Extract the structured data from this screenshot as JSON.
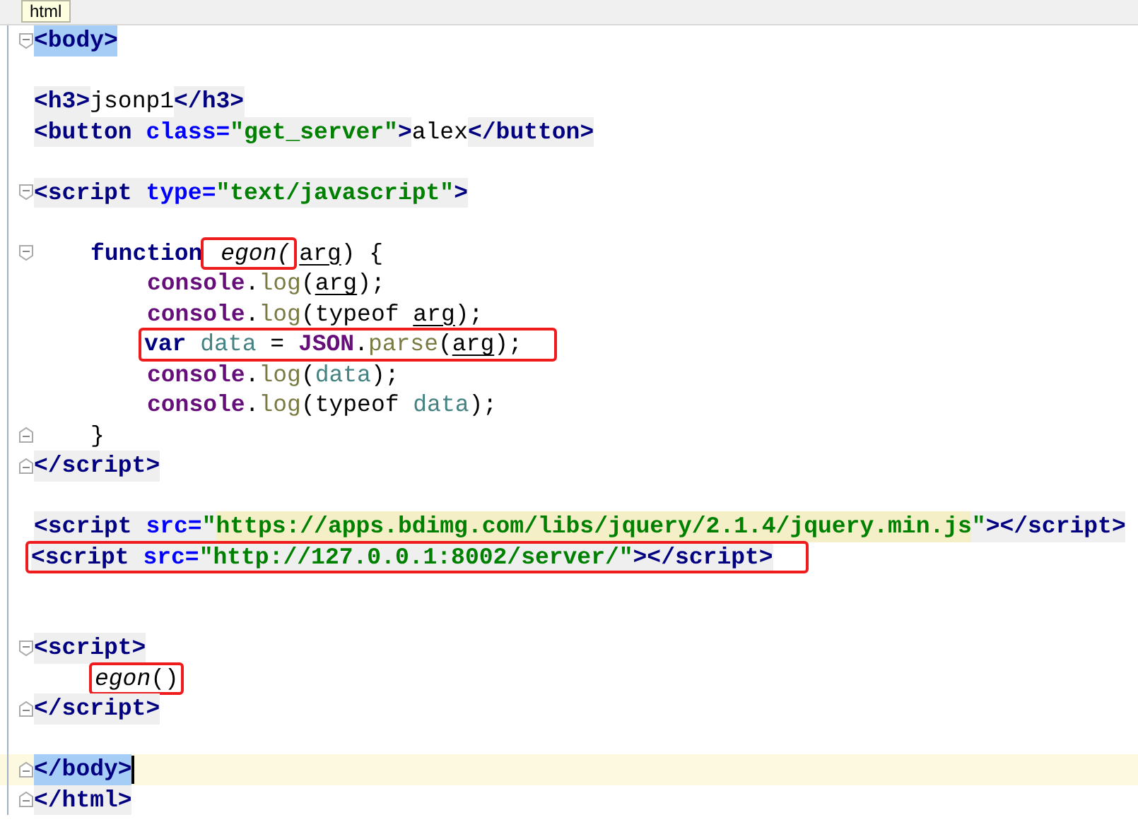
{
  "breadcrumb_tooltip": "html",
  "lines": [
    {
      "kind": "code",
      "fold_start": true,
      "tokens": [
        {
          "text": "<body>",
          "kind": "tag",
          "matched": true
        }
      ]
    },
    {
      "kind": "blank"
    },
    {
      "kind": "code",
      "tokens": [
        {
          "text": "<h3>",
          "kind": "tag"
        },
        {
          "text": "jsonp1",
          "kind": "text"
        },
        {
          "text": "</h3>",
          "kind": "tag"
        }
      ]
    },
    {
      "kind": "code",
      "tokens": [
        {
          "text": "<button ",
          "kind": "tag"
        },
        {
          "text": "class=",
          "kind": "attr"
        },
        {
          "text": "\"get_server\"",
          "kind": "string"
        },
        {
          "text": ">",
          "kind": "tag"
        },
        {
          "text": "alex",
          "kind": "text"
        },
        {
          "text": "</button>",
          "kind": "tag"
        }
      ]
    },
    {
      "kind": "blank"
    },
    {
      "kind": "code",
      "fold_start": true,
      "tokens": [
        {
          "text": "<script ",
          "kind": "tag"
        },
        {
          "text": "type=",
          "kind": "attr"
        },
        {
          "text": "\"text/javascript\"",
          "kind": "string"
        },
        {
          "text": ">",
          "kind": "tag"
        }
      ],
      "children": [
        {
          "kind": "blank"
        },
        {
          "kind": "code",
          "fold_start": true,
          "tokens": [
            {
              "text": "function",
              "kind": "keyword"
            },
            {
              "text": " egon(",
              "kind": "call",
              "boxed": true
            },
            {
              "text": "arg",
              "kind": "param"
            },
            {
              "text": ") {",
              "kind": "text"
            }
          ],
          "children": [
            {
              "kind": "code",
              "tokens": [
                {
                  "text": "console",
                  "kind": "object"
                },
                {
                  "text": ".",
                  "kind": "text"
                },
                {
                  "text": "log",
                  "kind": "method"
                },
                {
                  "text": "(",
                  "kind": "text"
                },
                {
                  "text": "arg",
                  "kind": "param"
                },
                {
                  "text": ");",
                  "kind": "text"
                }
              ]
            },
            {
              "kind": "code",
              "tokens": [
                {
                  "text": "console",
                  "kind": "object"
                },
                {
                  "text": ".",
                  "kind": "text"
                },
                {
                  "text": "log",
                  "kind": "method"
                },
                {
                  "text": "(typeof ",
                  "kind": "text"
                },
                {
                  "text": "arg",
                  "kind": "param"
                },
                {
                  "text": ");",
                  "kind": "text"
                }
              ]
            },
            {
              "kind": "code",
              "boxed": true,
              "tokens": [
                {
                  "text": "var",
                  "kind": "keyword"
                },
                {
                  "text": " data",
                  "kind": "variable"
                },
                {
                  "text": " = ",
                  "kind": "text"
                },
                {
                  "text": "JSON",
                  "kind": "object"
                },
                {
                  "text": ".",
                  "kind": "text"
                },
                {
                  "text": "parse",
                  "kind": "method"
                },
                {
                  "text": "(",
                  "kind": "text"
                },
                {
                  "text": "arg",
                  "kind": "param"
                },
                {
                  "text": ");",
                  "kind": "text"
                }
              ]
            },
            {
              "kind": "code",
              "tokens": [
                {
                  "text": "console",
                  "kind": "object"
                },
                {
                  "text": ".",
                  "kind": "text"
                },
                {
                  "text": "log",
                  "kind": "method"
                },
                {
                  "text": "(",
                  "kind": "text"
                },
                {
                  "text": "data",
                  "kind": "variable"
                },
                {
                  "text": ");",
                  "kind": "text"
                }
              ]
            },
            {
              "kind": "code",
              "tokens": [
                {
                  "text": "console",
                  "kind": "object"
                },
                {
                  "text": ".",
                  "kind": "text"
                },
                {
                  "text": "log",
                  "kind": "method"
                },
                {
                  "text": "(typeof ",
                  "kind": "text"
                },
                {
                  "text": "data",
                  "kind": "variable"
                },
                {
                  "text": ");",
                  "kind": "text"
                }
              ]
            }
          ]
        },
        {
          "kind": "code",
          "fold_end": true,
          "tokens": [
            {
              "text": "}",
              "kind": "text"
            }
          ]
        }
      ]
    },
    {
      "kind": "code",
      "fold_end": true,
      "tokens": [
        {
          "text": "</script>",
          "kind": "tag"
        }
      ]
    },
    {
      "kind": "blank"
    },
    {
      "kind": "code",
      "tokens": [
        {
          "text": "<script ",
          "kind": "tag"
        },
        {
          "text": "src=",
          "kind": "attr"
        },
        {
          "text": "\"",
          "kind": "string"
        },
        {
          "text": "https://apps.bdimg.com/libs/jquery/2.1.4/jquery.min.js",
          "kind": "string",
          "injected": true
        },
        {
          "text": "\"",
          "kind": "string"
        },
        {
          "text": "></script>",
          "kind": "tag"
        }
      ]
    },
    {
      "kind": "code",
      "boxed": true,
      "tokens": [
        {
          "text": "<script ",
          "kind": "tag"
        },
        {
          "text": "src=",
          "kind": "attr"
        },
        {
          "text": "\"http://127.0.0.1:8002/server/\"",
          "kind": "string"
        },
        {
          "text": "></script>",
          "kind": "tag"
        }
      ]
    },
    {
      "kind": "blank"
    },
    {
      "kind": "blank"
    },
    {
      "kind": "code",
      "fold_start": true,
      "tokens": [
        {
          "text": "<script>",
          "kind": "tag"
        }
      ],
      "children": [
        {
          "kind": "code",
          "tokens": [
            {
              "text": "egon",
              "kind": "call",
              "boxed": true
            },
            {
              "text": "()",
              "kind": "text",
              "boxed": true
            }
          ]
        }
      ]
    },
    {
      "kind": "code",
      "fold_end": true,
      "tokens": [
        {
          "text": "</script>",
          "kind": "tag"
        }
      ]
    },
    {
      "kind": "blank"
    },
    {
      "kind": "code",
      "fold_end": true,
      "current": true,
      "tokens": [
        {
          "text": "</body>",
          "kind": "tag",
          "matched": true
        }
      ]
    },
    {
      "kind": "code",
      "fold_end": true,
      "tokens": [
        {
          "text": "</html>",
          "kind": "tag"
        }
      ]
    }
  ]
}
